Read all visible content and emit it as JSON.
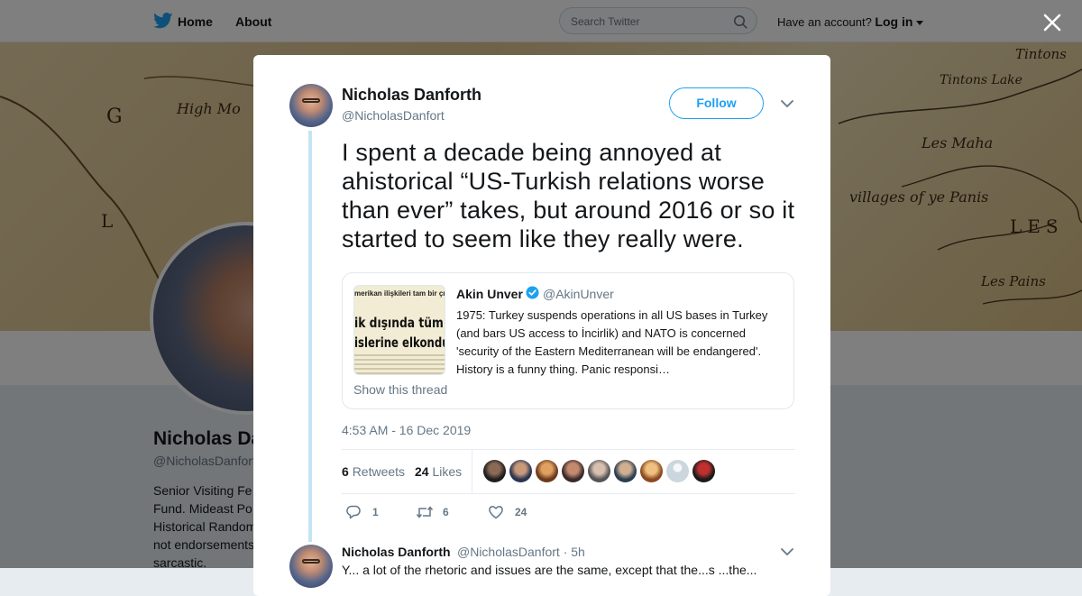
{
  "topbar": {
    "home_label": "Home",
    "about_label": "About",
    "search_placeholder": "Search Twitter",
    "account_prompt": "Have an account?",
    "login_label": "Log in"
  },
  "banner": {
    "labels": [
      "Tintons",
      "Tintons Lake",
      "Les Maha",
      "villages of ye Panis",
      "LES",
      "Les Pains",
      "High Mo",
      "G",
      "L"
    ]
  },
  "profile": {
    "name": "Nicholas Danforth",
    "handle": "@NicholasDanforth",
    "bio_lines": [
      "Senior Visiting Fe",
      "Fund. Mideast Po",
      "Historical Random",
      "not endorsements",
      "sarcastic."
    ]
  },
  "tweet": {
    "author_name": "Nicholas Danforth",
    "author_handle": "@NicholasDanfort",
    "follow_label": "Follow",
    "text": "I spent a decade being annoyed at ahistorical “US-Turkish relations worse than ever” takes, but around 2016 or so it started to seem like they really were.",
    "timestamp": "4:53 AM - 16 Dec 2019",
    "retweets_count": "6",
    "retweets_label": "Retweets",
    "likes_count": "24",
    "likes_label": "Likes",
    "actions": {
      "reply_count": "1",
      "retweet_count": "6",
      "like_count": "24"
    }
  },
  "quote": {
    "author_name": "Akin Unver",
    "author_handle": "@AkinUnver",
    "text": "1975: Turkey suspends operations in all US bases in Turkey (and bars US access to İncirlik) and NATO is concerned 'security of the Eastern Mediterranean will be endangered'. History is a funny thing. Panic responsi…",
    "image_lines": [
      "merikan ilişkileri tam bir çıkm",
      "ik dışında tüm",
      "islerine elkondu"
    ],
    "show_thread_label": "Show this thread"
  },
  "reply": {
    "author_name": "Nicholas Danforth",
    "author_handle": "@NicholasDanfort · 5h",
    "text": "Y... a lot of the rhetoric and issues are the same, except that the...s ...the..."
  },
  "colors": {
    "brand_blue": "#1da1f2",
    "thread_line": "#c4e4f5",
    "muted_text": "#657786"
  }
}
